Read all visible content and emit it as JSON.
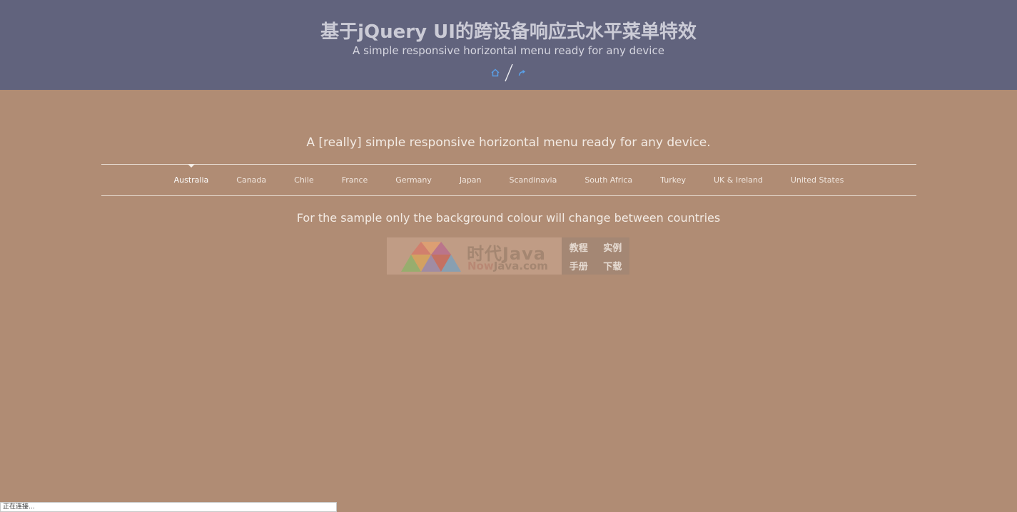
{
  "header": {
    "title": "基于jQuery UI的跨设备响应式水平菜单特效",
    "subtitle": "A simple responsive horizontal menu ready for any device",
    "links": [
      {
        "icon": "home-icon"
      },
      {
        "icon": "share-arrow-icon"
      }
    ]
  },
  "main": {
    "tagline": "A [really] simple responsive horizontal menu ready for any device.",
    "note": "For the sample only the background colour will change between countries"
  },
  "menu": {
    "active_index": 0,
    "items": [
      {
        "label": "Australia"
      },
      {
        "label": "Canada"
      },
      {
        "label": "Chile"
      },
      {
        "label": "France"
      },
      {
        "label": "Germany"
      },
      {
        "label": "Japan"
      },
      {
        "label": "Scandinavia"
      },
      {
        "label": "South Africa"
      },
      {
        "label": "Turkey"
      },
      {
        "label": "UK & Ireland"
      },
      {
        "label": "United States"
      }
    ]
  },
  "banner": {
    "name": "时代Java",
    "domain_prefix": "Now",
    "domain_rest": "Java.com",
    "tags": [
      "教程",
      "实例",
      "手册",
      "下载"
    ]
  },
  "status": {
    "text": "正在连接..."
  },
  "colors": {
    "header_bg": "#61637d",
    "page_bg": "#b08c74",
    "icon_blue": "#5aa0e8"
  }
}
